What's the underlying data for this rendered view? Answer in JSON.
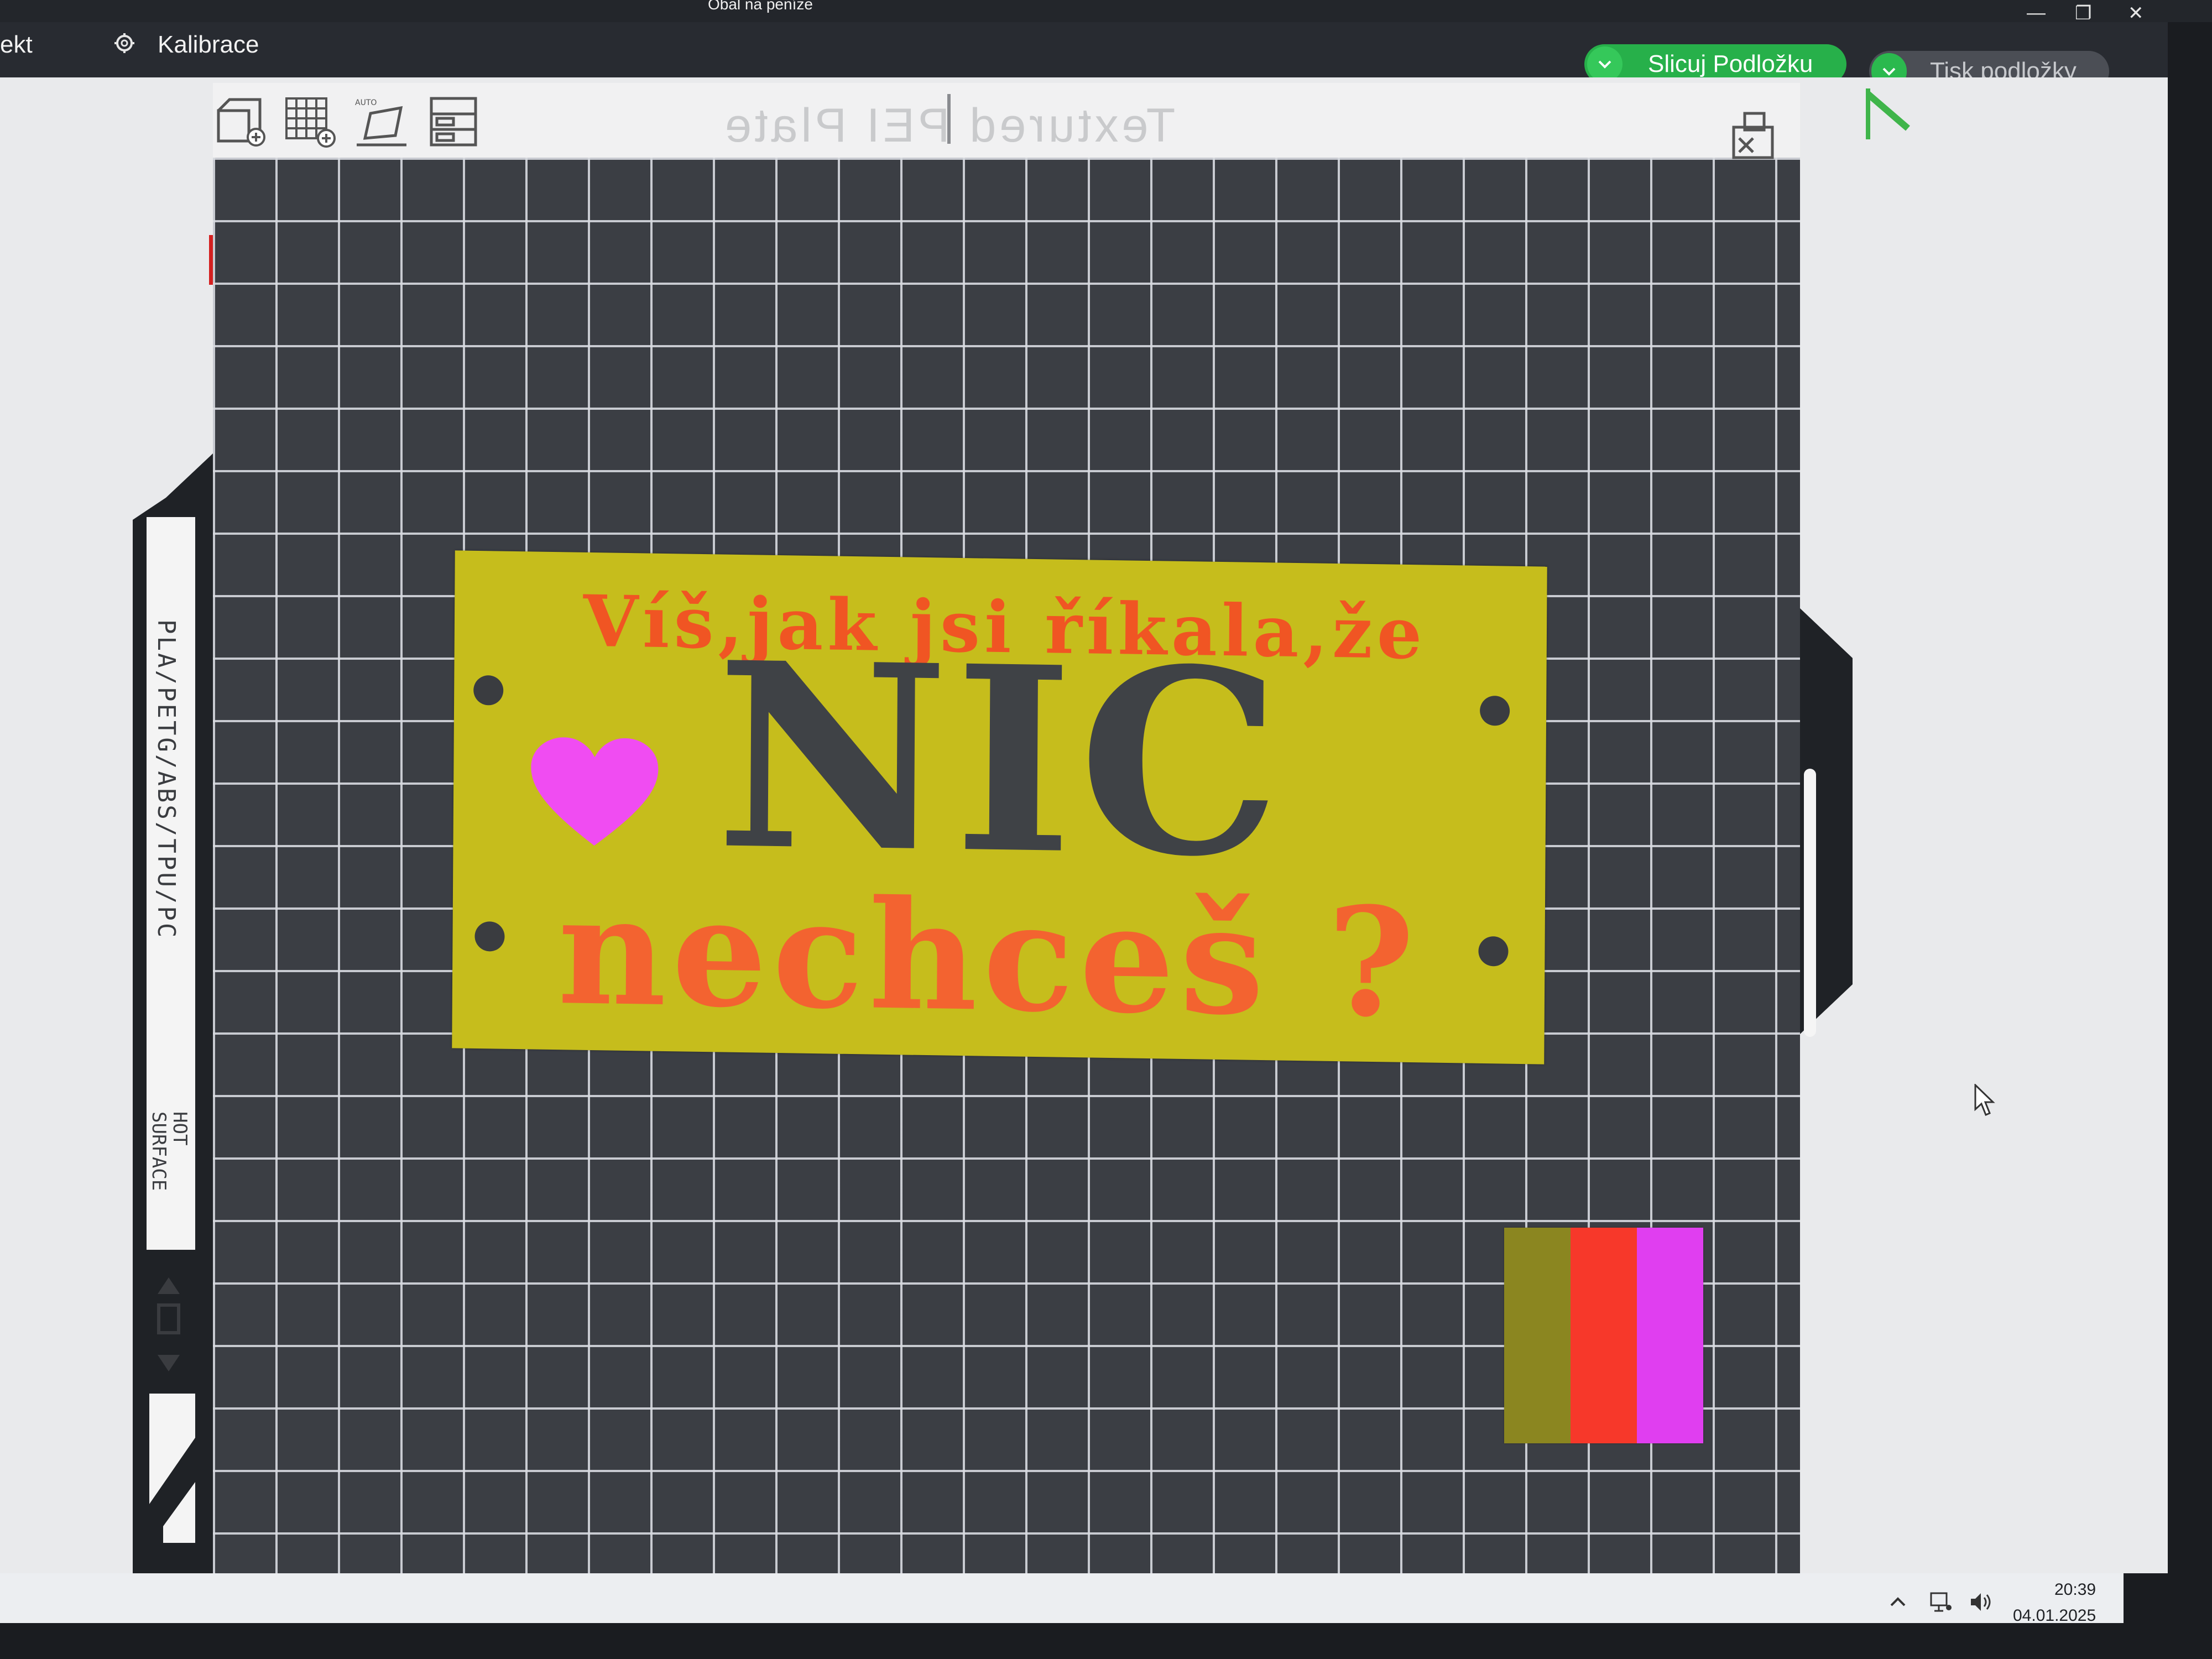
{
  "window": {
    "title": "Obal na peníze"
  },
  "menubar": {
    "left_partial": "ekt",
    "calibration": "Kalibrace",
    "gear_icon": "gear-icon"
  },
  "actions": {
    "slice_label": "Slicuj Podložku",
    "print_label": "Tisk podložky",
    "accent": "#27b04a"
  },
  "plate": {
    "name_mirrored": "Textured PEI Plate",
    "side_label": "PLA/PETG/ABS/TPU/PC",
    "hot_label_line1": "HOT",
    "hot_label_line2": "SURFACE"
  },
  "model": {
    "line1": "Víš,jak jsi říkala,že",
    "line2": "NIC",
    "line3": "nechceš ?",
    "colors": {
      "base": "#c6bd1c",
      "accent_text": "#f05523",
      "big_text": "#3f4246",
      "heart": "#f04cf2"
    }
  },
  "swatch": {
    "colors": [
      "#8b8620",
      "#f7382a",
      "#e03ef0"
    ]
  },
  "tray": {
    "time": "20:39",
    "date": "04.01.2025"
  }
}
